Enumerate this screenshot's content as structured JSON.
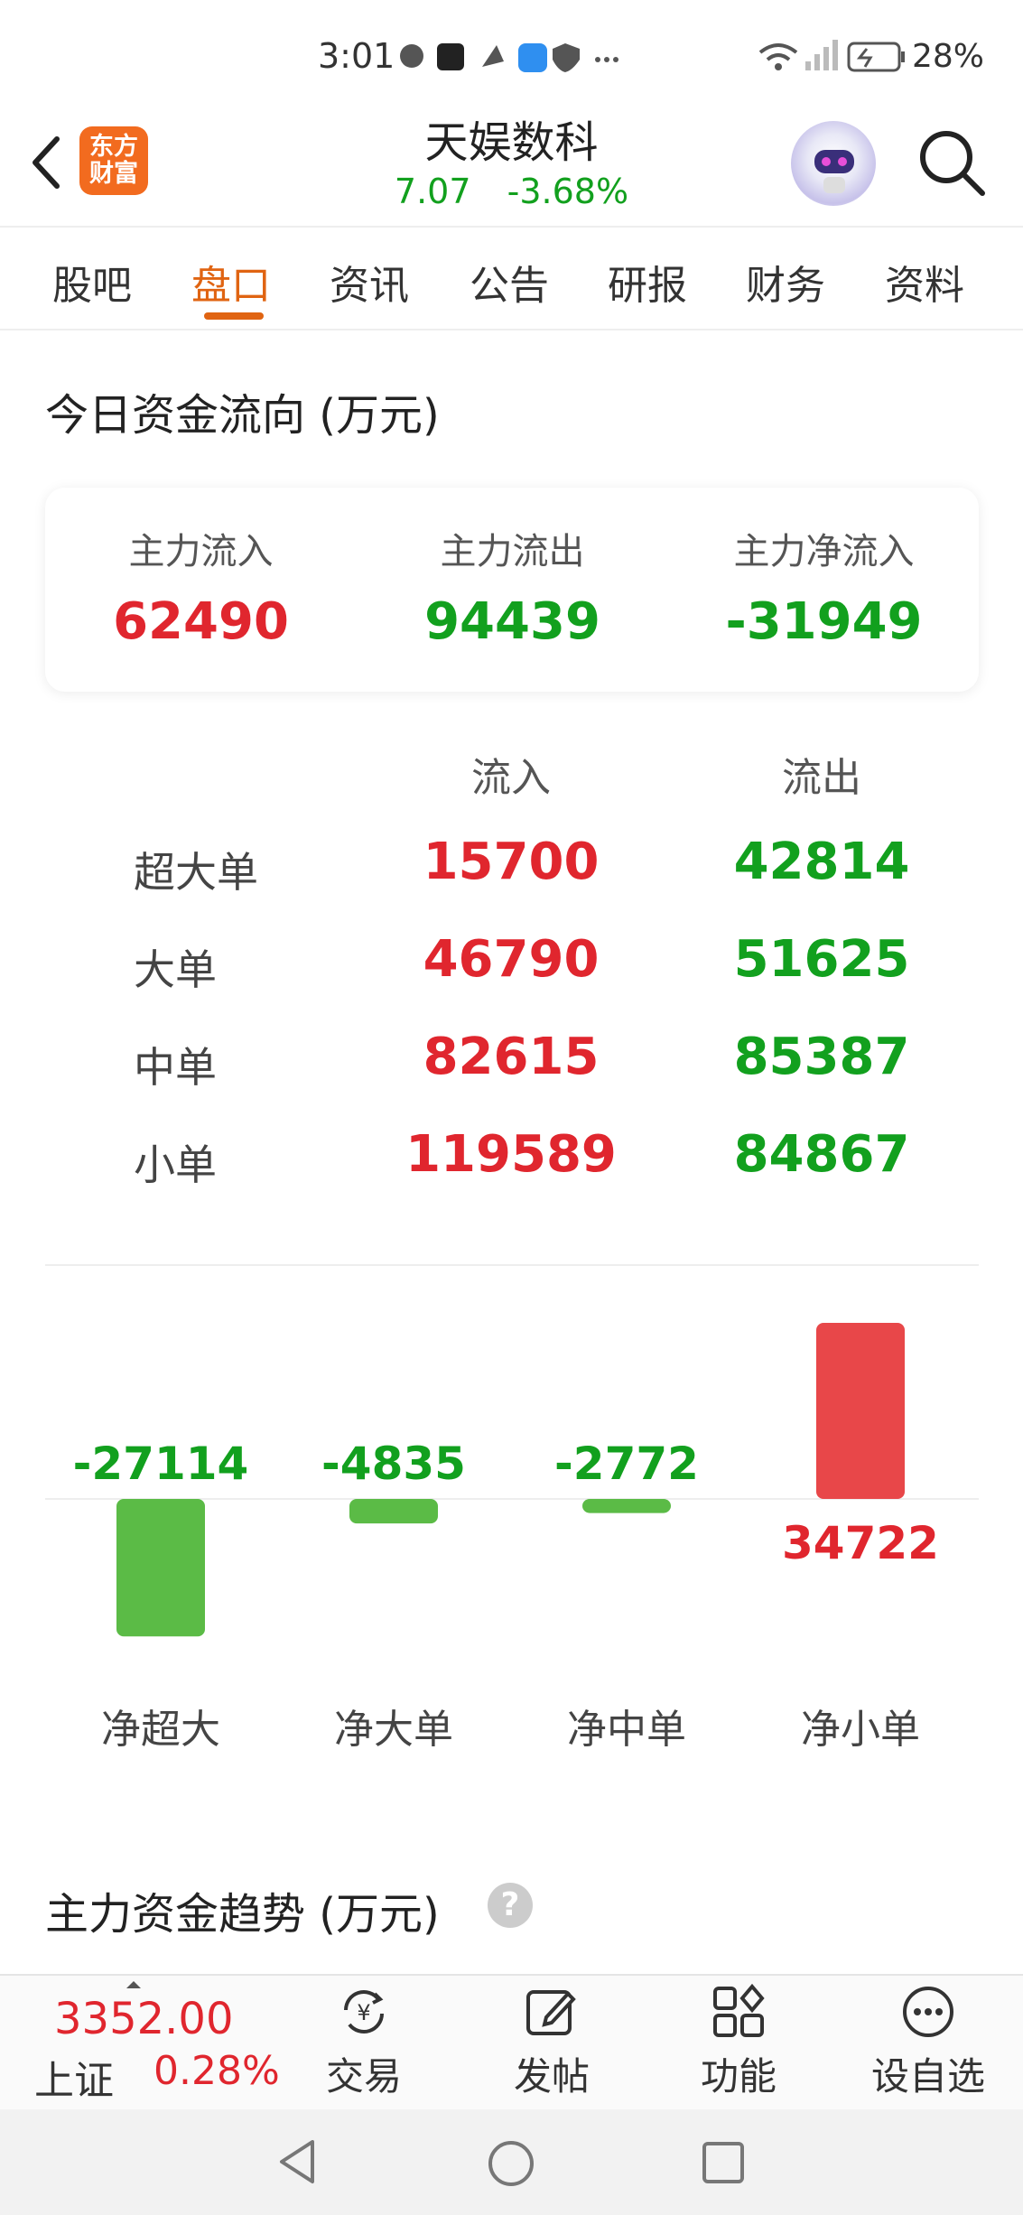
{
  "status_bar": {
    "time": "3:01",
    "battery": "28%"
  },
  "header": {
    "logo_line1": "东方",
    "logo_line2": "财富",
    "stock_name": "天娱数科",
    "price": "7.07",
    "change_pct": "-3.68%"
  },
  "tabs": [
    "股吧",
    "盘口",
    "资讯",
    "公告",
    "研报",
    "财务",
    "资料"
  ],
  "active_tab": "盘口",
  "fund_flow": {
    "title": "今日资金流向 (万元)",
    "summary": [
      {
        "label": "主力流入",
        "value": "62490"
      },
      {
        "label": "主力流出",
        "value": "94439"
      },
      {
        "label": "主力净流入",
        "value": "-31949"
      }
    ],
    "headers": {
      "inflow": "流入",
      "outflow": "流出"
    },
    "rows": [
      {
        "label": "超大单",
        "inflow": "15700",
        "outflow": "42814"
      },
      {
        "label": "大单",
        "inflow": "46790",
        "outflow": "51625"
      },
      {
        "label": "中单",
        "inflow": "82615",
        "outflow": "85387"
      },
      {
        "label": "小单",
        "inflow": "119589",
        "outflow": "84867"
      }
    ]
  },
  "chart_data": {
    "type": "bar",
    "categories": [
      "净超大",
      "净大单",
      "净中单",
      "净小单"
    ],
    "values": [
      -27114,
      -4835,
      -2772,
      34722
    ],
    "value_labels": [
      "-27114",
      "-4835",
      "-2772",
      "34722"
    ],
    "title": "",
    "xlabel": "",
    "ylabel": "",
    "colors": {
      "positive": "#e84749",
      "negative": "#5bbb46"
    }
  },
  "trend": {
    "title": "主力资金趋势 (万元)",
    "help": "?"
  },
  "bottom_bar": {
    "index_value": "3352.00",
    "index_name": "上证",
    "index_pct": "0.28%",
    "items": [
      {
        "label": "交易",
        "icon": "exchange-yen-icon"
      },
      {
        "label": "发帖",
        "icon": "edit-post-icon"
      },
      {
        "label": "功能",
        "icon": "grid-apps-icon"
      },
      {
        "label": "设自选",
        "icon": "more-circle-icon"
      }
    ]
  }
}
